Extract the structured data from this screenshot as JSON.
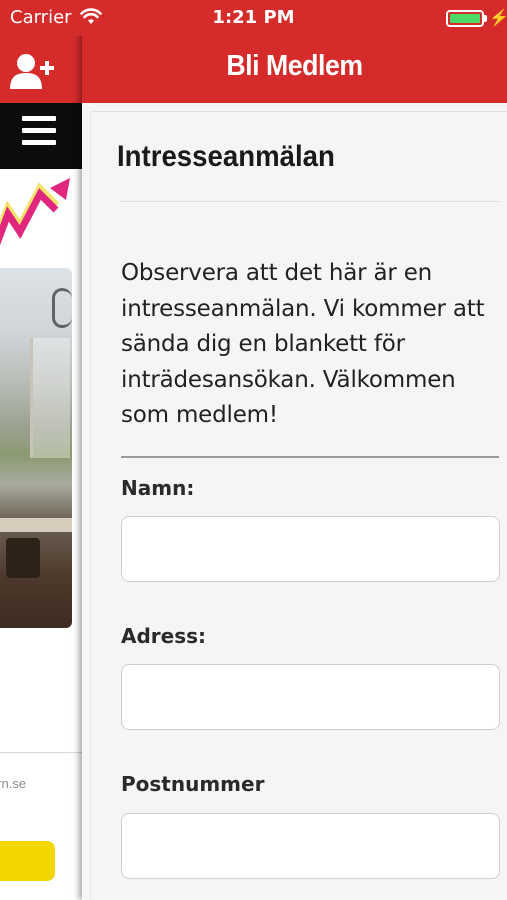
{
  "status_bar": {
    "carrier": "Carrier",
    "time": "1:21 PM",
    "battery_level": 1.0,
    "battery_color": "#4cd964"
  },
  "left_panel": {
    "add_user_icon": "add-user-icon",
    "menu_icon": "hamburger-menu-icon",
    "email_fragment": "ern.se",
    "accent_color": "#f3d500"
  },
  "header": {
    "title": "Bli Medlem",
    "color": "#d52b2b"
  },
  "form": {
    "title": "Intresseanmälan",
    "intro": "Observera att det här är en intresseanmälan. Vi kommer att sända dig en blankett för inträdesansökan. Välkommen som medlem!",
    "fields": [
      {
        "label": "Namn:",
        "value": ""
      },
      {
        "label": "Adress:",
        "value": ""
      },
      {
        "label": "Postnummer",
        "value": ""
      }
    ]
  }
}
